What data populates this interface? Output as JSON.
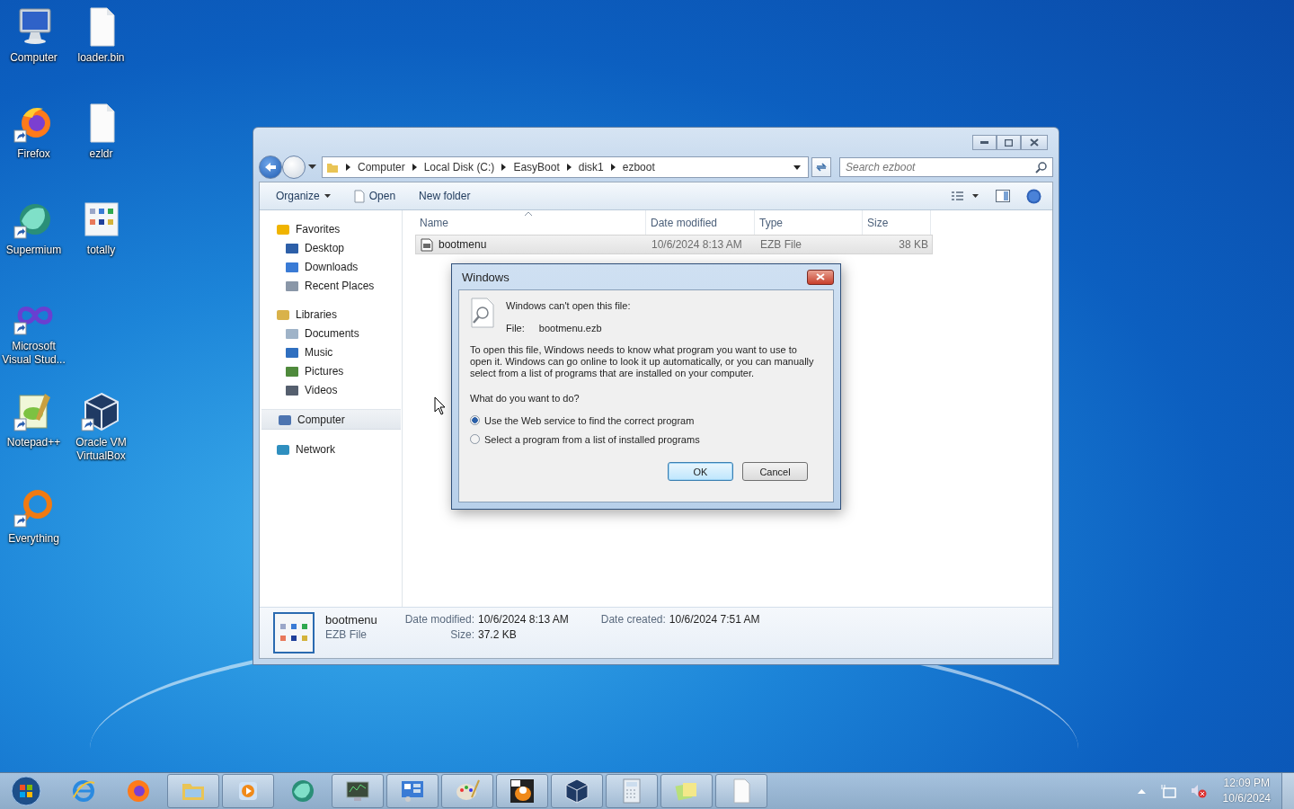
{
  "desktop": {
    "icon_rows": [
      [
        {
          "label": "Computer",
          "kind": "computer",
          "shortcut": false
        },
        {
          "label": "loader.bin",
          "kind": "file",
          "shortcut": false
        }
      ],
      [
        {
          "label": "Firefox",
          "kind": "firefox",
          "shortcut": true
        },
        {
          "label": "ezldr",
          "kind": "file",
          "shortcut": false
        }
      ],
      [
        {
          "label": "Supermium",
          "kind": "supermium",
          "shortcut": true
        },
        {
          "label": "totally",
          "kind": "grid",
          "shortcut": false
        }
      ],
      [
        {
          "label": "Microsoft Visual Stud...",
          "kind": "infinity",
          "shortcut": true
        }
      ],
      [
        {
          "label": "Notepad++",
          "kind": "notepad",
          "shortcut": true
        },
        {
          "label": "Oracle VM VirtualBox",
          "kind": "cube",
          "shortcut": true
        }
      ],
      [
        {
          "label": "Everything",
          "kind": "ring",
          "shortcut": true
        }
      ]
    ]
  },
  "explorer": {
    "breadcrumb": [
      "Computer",
      "Local Disk (C:)",
      "EasyBoot",
      "disk1",
      "ezboot"
    ],
    "search": {
      "placeholder": "Search ezboot"
    },
    "toolbar": [
      {
        "label": "Organize",
        "kind": "menu"
      },
      {
        "label": "Open",
        "kind": "file"
      },
      {
        "label": "New folder",
        "kind": "plain"
      }
    ],
    "nav": [
      {
        "label": "Favorites",
        "kind": "star",
        "selected": false,
        "children": [
          {
            "label": "Desktop",
            "kind": "desktop",
            "selected": false
          },
          {
            "label": "Downloads",
            "kind": "downloads",
            "selected": false
          },
          {
            "label": "Recent Places",
            "kind": "recent",
            "selected": false
          }
        ]
      },
      {
        "label": "Libraries",
        "kind": "libraries",
        "selected": false,
        "children": [
          {
            "label": "Documents",
            "kind": "documents",
            "selected": false
          },
          {
            "label": "Music",
            "kind": "music",
            "selected": false
          },
          {
            "label": "Pictures",
            "kind": "pictures",
            "selected": false
          },
          {
            "label": "Videos",
            "kind": "videos",
            "selected": false
          }
        ]
      },
      {
        "label": "Computer",
        "kind": "computer",
        "selected": true
      },
      {
        "label": "Network",
        "kind": "network",
        "selected": false
      }
    ],
    "columns": [
      "Name",
      "Date modified",
      "Type",
      "Size"
    ],
    "rows": [
      {
        "name": "bootmenu",
        "date": "10/6/2024 8:13 AM",
        "type": "EZB File",
        "size": "38 KB",
        "selected": true
      }
    ],
    "details": {
      "name": "bootmenu",
      "type": "EZB File",
      "fields": [
        {
          "label": "Date modified:",
          "value": "10/6/2024 8:13 AM"
        },
        {
          "label": "Size:",
          "value": "37.2 KB"
        },
        {
          "label": "Date created:",
          "value": "10/6/2024 7:51 AM"
        }
      ]
    }
  },
  "dialog": {
    "title": "Windows",
    "heading": "Windows can't open this file:",
    "file_label": "File:",
    "file_name": "bootmenu.ezb",
    "message": "To open this file, Windows needs to know what program you want to use to open it. Windows can go online to look it up automatically, or you can manually select from a list of programs that are installed on your computer.",
    "question": "What do you want to do?",
    "options": [
      {
        "label": "Use the Web service to find the correct program",
        "selected": true
      },
      {
        "label": "Select a program from a list of installed programs",
        "selected": false
      }
    ],
    "buttons": [
      {
        "label": "OK",
        "default": true
      },
      {
        "label": "Cancel",
        "default": false
      }
    ]
  },
  "taskbar": {
    "apps": [
      {
        "kind": "ie",
        "running": false
      },
      {
        "kind": "firefox",
        "running": false
      },
      {
        "kind": "folder",
        "running": true
      },
      {
        "kind": "media",
        "running": true
      },
      {
        "kind": "supermium",
        "running": false
      },
      {
        "kind": "monitor",
        "running": true
      },
      {
        "kind": "panel",
        "running": true
      },
      {
        "kind": "paint",
        "running": true
      },
      {
        "kind": "penguin",
        "running": true
      },
      {
        "kind": "cube",
        "running": true
      },
      {
        "kind": "calculator",
        "running": true
      },
      {
        "kind": "sticky",
        "running": true
      },
      {
        "kind": "file",
        "running": true
      }
    ],
    "time": "12:09 PM",
    "date": "10/6/2024"
  }
}
